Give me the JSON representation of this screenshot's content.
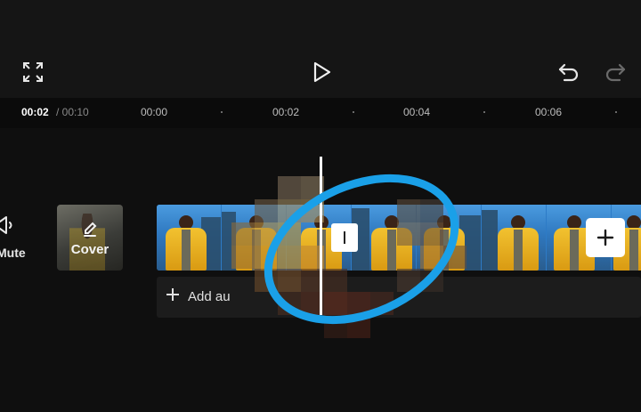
{
  "toolbar": {
    "fullscreen_icon": "expand-icon",
    "play_icon": "play-icon",
    "undo_icon": "undo-icon",
    "redo_icon": "redo-icon"
  },
  "ruler": {
    "current_time": "00:02",
    "total_time": "/ 00:10",
    "ticks": [
      "00:00",
      "00:02",
      "00:04",
      "00:06"
    ]
  },
  "sidebar": {
    "mute_label": "Mute",
    "cover_label": "Cover"
  },
  "tracks": {
    "add_audio_label": "Add au"
  },
  "colors": {
    "annotation_ring": "#1aa0e8",
    "jacket": "#f2c230",
    "sky": "#2d7bc7"
  }
}
